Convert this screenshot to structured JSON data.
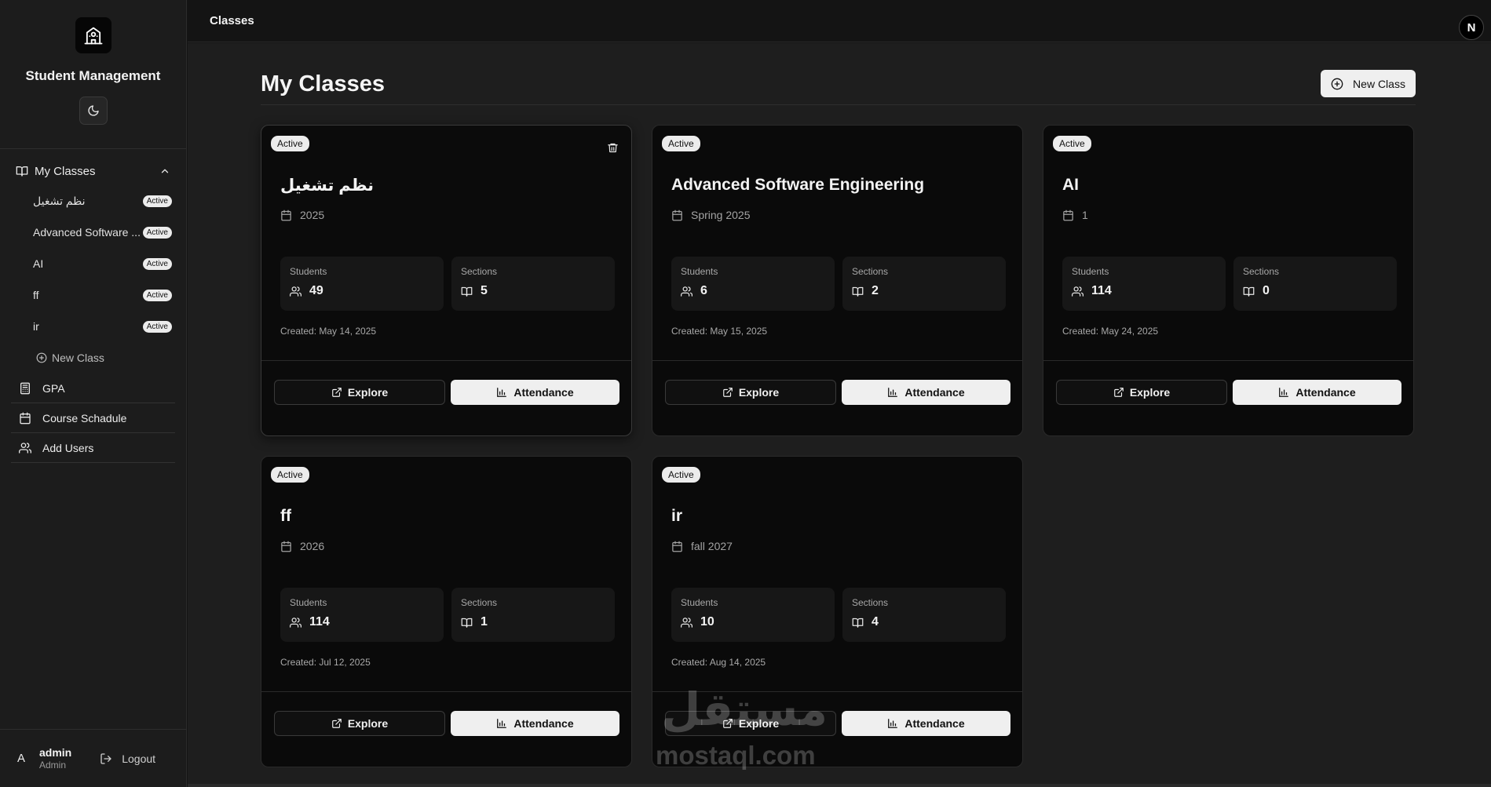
{
  "app": {
    "title": "Student Management"
  },
  "sidebar": {
    "section_label": "My Classes",
    "classes": [
      {
        "name": "نظم تشغيل",
        "status": "Active"
      },
      {
        "name": "Advanced Software ...",
        "status": "Active"
      },
      {
        "name": "AI",
        "status": "Active"
      },
      {
        "name": "ff",
        "status": "Active"
      },
      {
        "name": "ir",
        "status": "Active"
      }
    ],
    "new_class_label": "New Class",
    "items": [
      {
        "label": "GPA",
        "icon": "calculator-icon"
      },
      {
        "label": "Course Schadule",
        "icon": "calendar-icon"
      },
      {
        "label": "Add Users",
        "icon": "users-icon"
      }
    ]
  },
  "user": {
    "initial": "A",
    "name": "admin",
    "role": "Admin",
    "logout_label": "Logout"
  },
  "topbar": {
    "breadcrumb": "Classes",
    "logo_letter": "N"
  },
  "main": {
    "title": "My Classes",
    "new_class_button": "New Class",
    "labels": {
      "students": "Students",
      "sections": "Sections",
      "explore": "Explore",
      "attendance": "Attendance"
    },
    "cards": [
      {
        "status": "Active",
        "title": "نظم تشغيل",
        "term": "2025",
        "students": "49",
        "sections": "5",
        "created": "Created: May 14, 2025"
      },
      {
        "status": "Active",
        "title": "Advanced Software Engineering",
        "term": "Spring 2025",
        "students": "6",
        "sections": "2",
        "created": "Created: May 15, 2025"
      },
      {
        "status": "Active",
        "title": "AI",
        "term": "1",
        "students": "114",
        "sections": "0",
        "created": "Created: May 24, 2025"
      },
      {
        "status": "Active",
        "title": "ff",
        "term": "2026",
        "students": "114",
        "sections": "1",
        "created": "Created: Jul 12, 2025"
      },
      {
        "status": "Active",
        "title": "ir",
        "term": "fall 2027",
        "students": "10",
        "sections": "4",
        "created": "Created: Aug 14, 2025"
      }
    ]
  },
  "watermark": {
    "arabic": "مستقل",
    "latin": "mostaql.com"
  }
}
